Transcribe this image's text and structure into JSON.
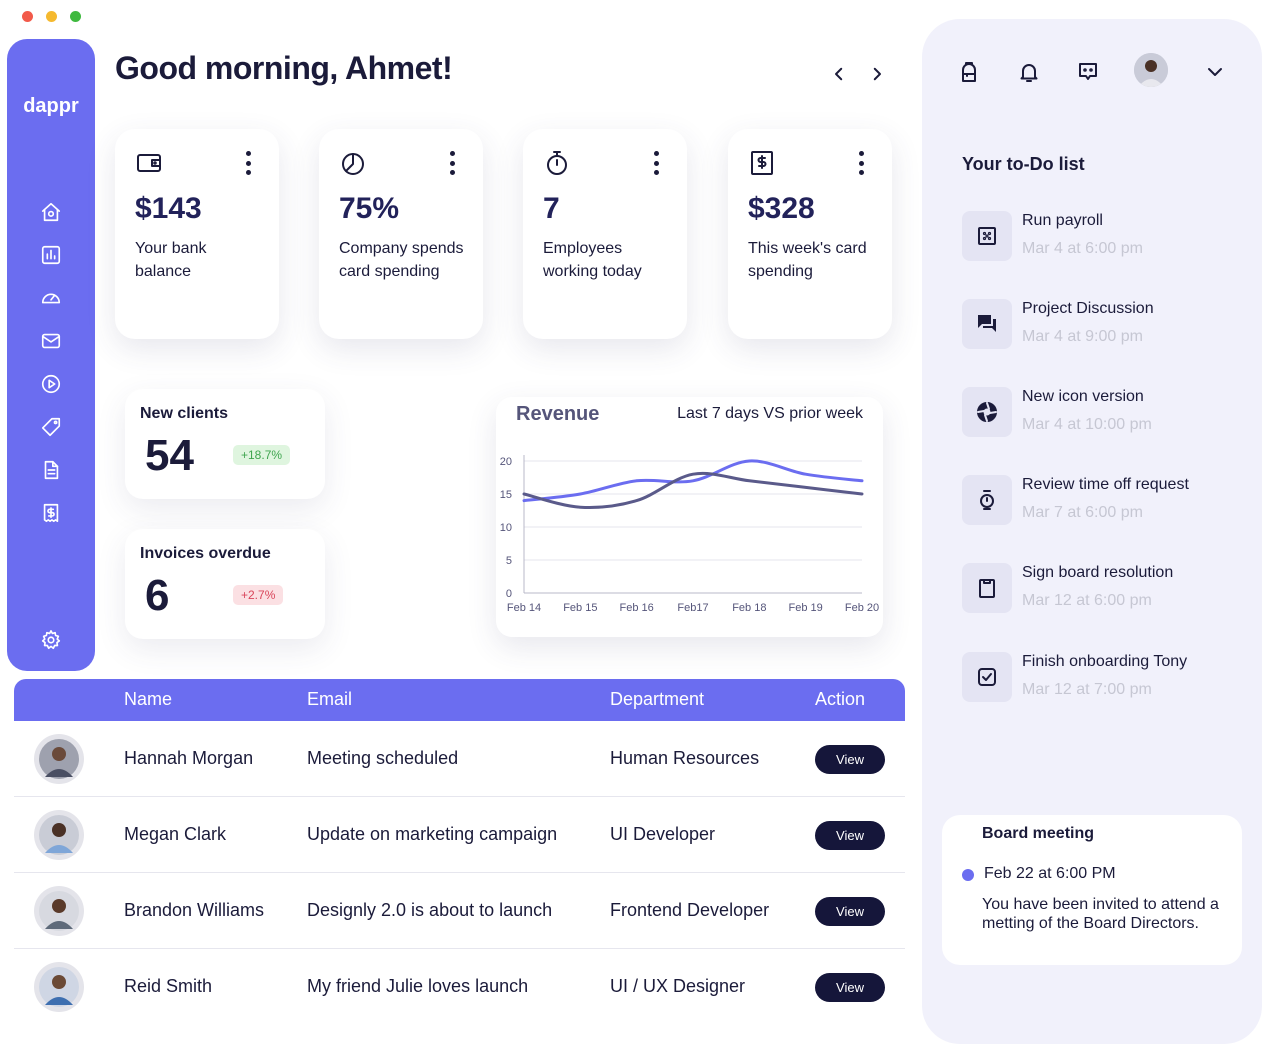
{
  "window": {
    "traffic_colors": [
      "#f25a4a",
      "#f5b92f",
      "#3fb93f"
    ]
  },
  "sidebar": {
    "brand": "dappr",
    "items": [
      {
        "icon": "home-icon"
      },
      {
        "icon": "bar-chart-icon"
      },
      {
        "icon": "speedometer-icon"
      },
      {
        "icon": "mail-icon"
      },
      {
        "icon": "play-circle-icon"
      },
      {
        "icon": "tag-icon"
      },
      {
        "icon": "document-icon"
      },
      {
        "icon": "dollar-receipt-icon"
      }
    ],
    "settings_icon": "gear-icon",
    "accent": "#6b6df0"
  },
  "header": {
    "greeting": "Good morning, Ahmet!",
    "prev_icon": "chevron-left-icon",
    "next_icon": "chevron-right-icon"
  },
  "stats": [
    {
      "icon": "wallet-icon",
      "value": "$143",
      "label": "Your bank balance"
    },
    {
      "icon": "pie-chart-icon",
      "value": "75%",
      "label": "Company spends card spending"
    },
    {
      "icon": "stopwatch-icon",
      "value": "7",
      "label": "Employees working today"
    },
    {
      "icon": "dollar-receipt-icon",
      "value": "$328",
      "label": "This week's card spending"
    }
  ],
  "mini_cards": {
    "new_clients": {
      "title": "New clients",
      "value": "54",
      "badge": "+18.7%"
    },
    "invoices": {
      "title": "Invoices overdue",
      "value": "6",
      "badge": "+2.7%"
    }
  },
  "revenue": {
    "title": "Revenue",
    "subtitle": "Last 7 days VS prior week"
  },
  "chart_data": {
    "type": "line",
    "title": "Revenue",
    "subtitle": "Last 7 days VS prior week",
    "x": [
      "Feb 14",
      "Feb 15",
      "Feb 16",
      "Feb17",
      "Feb 18",
      "Feb 19",
      "Feb 20"
    ],
    "y_ticks": [
      0,
      5,
      10,
      15,
      20
    ],
    "ylim": [
      0,
      20
    ],
    "grid": true,
    "series": [
      {
        "values": [
          14,
          15,
          17,
          17,
          20,
          18,
          17
        ],
        "color": "#6b6df0"
      },
      {
        "values": [
          15,
          13,
          14,
          18,
          17,
          16,
          15
        ],
        "color": "#5a5a8a"
      }
    ]
  },
  "table": {
    "headers": {
      "name": "Name",
      "email": "Email",
      "department": "Department",
      "action": "Action"
    },
    "rows": [
      {
        "name": "Hannah Morgan",
        "email": "Meeting scheduled",
        "department": "Human Resources",
        "action": "View"
      },
      {
        "name": "Megan Clark",
        "email": "Update on marketing campaign",
        "department": "UI Developer",
        "action": "View"
      },
      {
        "name": "Brandon Williams",
        "email": "Designly 2.0 is about to launch",
        "department": "Frontend Developer",
        "action": "View"
      },
      {
        "name": "Reid Smith",
        "email": "My friend Julie loves launch",
        "department": "UI / UX Designer",
        "action": "View"
      }
    ]
  },
  "right_panel": {
    "icons": [
      "backpack-icon",
      "bell-icon",
      "chat-icon",
      "chevron-down-icon"
    ],
    "todo_title": "Your to-Do list",
    "todos": [
      {
        "icon": "grid-icon",
        "name": "Run payroll",
        "time": "Mar 4 at 6:00 pm"
      },
      {
        "icon": "chat-bubbles-icon",
        "name": "Project Discussion",
        "time": "Mar 4 at 9:00 pm"
      },
      {
        "icon": "aperture-icon",
        "name": "New icon version",
        "time": "Mar 4 at 10:00 pm"
      },
      {
        "icon": "watch-icon",
        "name": "Review time off request",
        "time": "Mar 7 at 6:00 pm"
      },
      {
        "icon": "clipboard-icon",
        "name": "Sign board resolution",
        "time": "Mar 12 at 6:00 pm"
      },
      {
        "icon": "checkbox-icon",
        "name": "Finish onboarding Tony",
        "time": "Mar 12 at 7:00 pm"
      }
    ],
    "meeting": {
      "title": "Board meeting",
      "date": "Feb 22 at 6:00 PM",
      "description": "You have been invited to attend a metting of the Board Directors."
    }
  }
}
